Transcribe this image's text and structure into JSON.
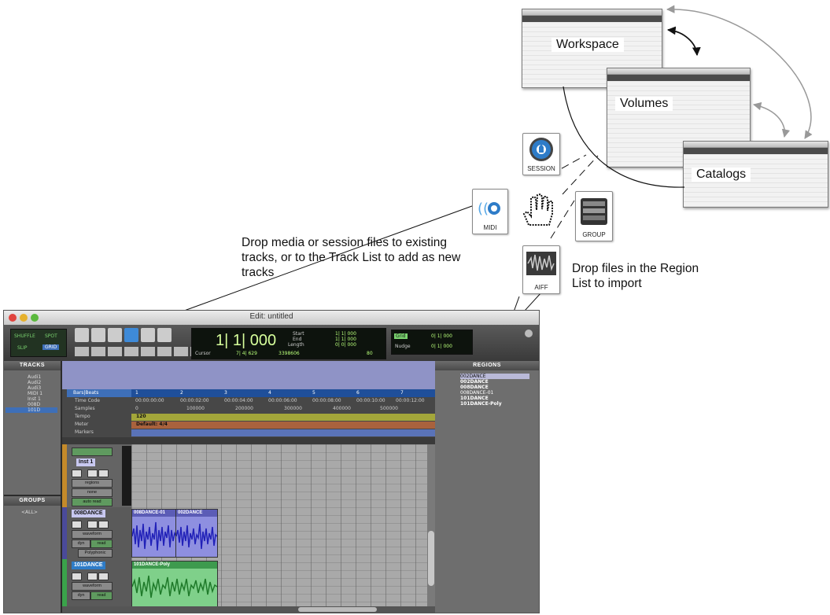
{
  "callouts": {
    "left_text": "Drop media or session files to existing tracks, or to the Track List to add as new tracks",
    "right_text": "Drop files in the Region List to import"
  },
  "browsers": {
    "workspace": "Workspace",
    "volumes": "Volumes",
    "catalogs": "Catalogs"
  },
  "file_icons": {
    "session": "SESSION",
    "midi": "MIDI",
    "group": "GROUP",
    "aiff": "AIFF"
  },
  "edit_window": {
    "title": "Edit: untitled",
    "edit_modes": [
      "SHUFFLE",
      "SPOT",
      "SLIP",
      "GRID"
    ],
    "main_counter": "1| 1| 000",
    "start_label": "Start",
    "end_label": "End",
    "length_label": "Length",
    "start_value": "1| 1| 000",
    "end_value": "1| 1| 000",
    "length_value": "0| 0| 000",
    "cursor_label": "Cursor",
    "cursor_value": "7| 4| 629",
    "sample_value": "3398606",
    "tempo_value": "80",
    "grid_label": "Grid",
    "grid_value": "0| 1| 000",
    "nudge_label": "Nudge",
    "nudge_value": "0| 1| 000"
  },
  "tracks_panel": {
    "header": "TRACKS",
    "items": [
      "Audi1",
      "Audi2",
      "Audi3",
      "MIDI 1",
      "Inst 1",
      "008D",
      "101D"
    ]
  },
  "groups_panel": {
    "header": "GROUPS",
    "items": [
      "<ALL>"
    ]
  },
  "regions_panel": {
    "header": "REGIONS",
    "items": [
      "002DANCE",
      "002DANCE",
      "008DANCE",
      "008DANCE-01",
      "101DANCE",
      "101DANCE-Poly"
    ]
  },
  "rulers": {
    "rows": [
      "Bars|Beats",
      "Time Code",
      "Samples",
      "Tempo",
      "Meter",
      "Markers"
    ],
    "bars": [
      "1",
      "2",
      "3",
      "4",
      "5",
      "6",
      "7"
    ],
    "timecode": [
      "00:00:00:00",
      "00:00:02:00",
      "00:00:04:00",
      "00:00:06:00",
      "00:00:08:00",
      "00:00:10:00",
      "00:00:12:00"
    ],
    "samples": [
      "0",
      "100000",
      "200000",
      "300000",
      "400000",
      "500000"
    ],
    "tempo_marker": "120",
    "meter_marker": "Default: 4/4"
  },
  "tracks": [
    {
      "name": "Inst 1",
      "view": "regions",
      "sub": "none",
      "auto": "auto read"
    },
    {
      "name": "008DANCE",
      "view": "waveform",
      "sub": "dyn",
      "auto": "read",
      "voice": "Polyphonic"
    },
    {
      "name": "101DANCE",
      "view": "waveform",
      "sub": "dyn",
      "auto": "read"
    }
  ],
  "clips": {
    "a": "008DANCE-01",
    "b": "002DANCE",
    "c": "101DANCE-Poly"
  },
  "colors": {
    "lcd_green": "#b8ff7a",
    "clip_blue": "#8e8fe0",
    "clip_green": "#7fd08a",
    "selected_track": "#3e6fb8"
  }
}
